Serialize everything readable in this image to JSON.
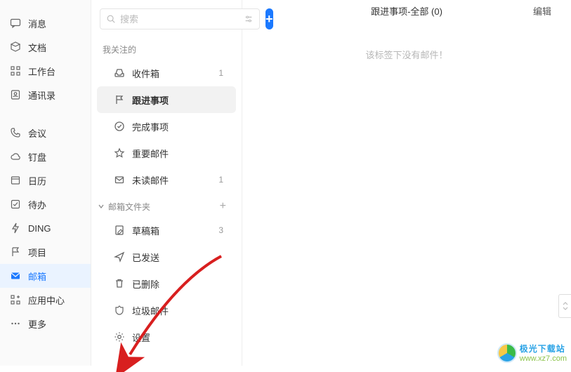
{
  "leftnav": {
    "group1": [
      {
        "label": "消息",
        "icon": "chat"
      },
      {
        "label": "文档",
        "icon": "doc"
      },
      {
        "label": "工作台",
        "icon": "grid"
      },
      {
        "label": "通讯录",
        "icon": "contacts"
      }
    ],
    "group2": [
      {
        "label": "会议",
        "icon": "phone"
      },
      {
        "label": "钉盘",
        "icon": "cloud"
      },
      {
        "label": "日历",
        "icon": "calendar"
      },
      {
        "label": "待办",
        "icon": "check"
      },
      {
        "label": "DING",
        "icon": "bolt"
      },
      {
        "label": "项目",
        "icon": "flag"
      },
      {
        "label": "邮箱",
        "icon": "mail",
        "active": true
      },
      {
        "label": "应用中心",
        "icon": "apps"
      },
      {
        "label": "更多",
        "icon": "more"
      }
    ]
  },
  "search": {
    "placeholder": "搜索"
  },
  "section_followed": "我关注的",
  "followed": [
    {
      "label": "收件箱",
      "count": "1",
      "icon": "inbox"
    },
    {
      "label": "跟进事项",
      "count": "",
      "icon": "flag",
      "selected": true
    },
    {
      "label": "完成事项",
      "count": "",
      "icon": "done"
    },
    {
      "label": "重要邮件",
      "count": "",
      "icon": "star"
    },
    {
      "label": "未读邮件",
      "count": "1",
      "icon": "mailopen"
    }
  ],
  "section_folders": "邮箱文件夹",
  "folders": [
    {
      "label": "草稿箱",
      "count": "3",
      "icon": "draft"
    },
    {
      "label": "已发送",
      "count": "",
      "icon": "send"
    },
    {
      "label": "已删除",
      "count": "",
      "icon": "trash"
    },
    {
      "label": "垃圾邮件",
      "count": "",
      "icon": "spam"
    },
    {
      "label": "设置",
      "count": "",
      "icon": "gear"
    }
  ],
  "content": {
    "header_title": "跟进事项-全部 (0)",
    "edit_label": "编辑",
    "empty_text": "该标签下没有邮件！"
  },
  "watermark": {
    "line1": "极光下载站",
    "line2": "www.xz7.com"
  }
}
